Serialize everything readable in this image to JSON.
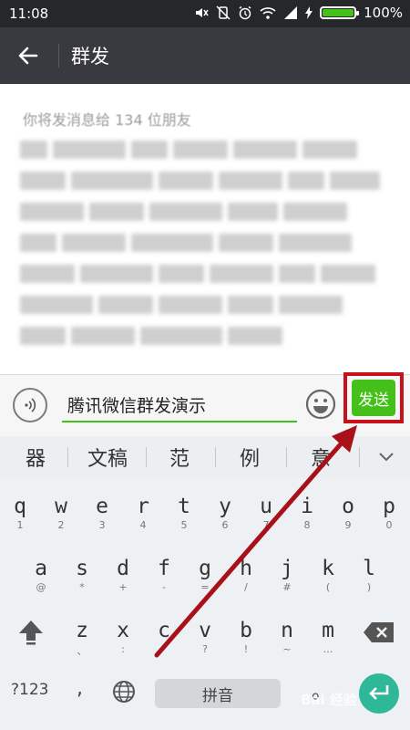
{
  "status_bar": {
    "time": "11:08",
    "battery_label": "100%",
    "battery_level": 1.0,
    "icons": [
      "mute-icon",
      "vibrate-off-icon",
      "alarm-icon",
      "wifi-icon",
      "signal-icon",
      "battery-icon"
    ]
  },
  "title_bar": {
    "back_icon": "back-arrow-icon",
    "title": "群发"
  },
  "content": {
    "recipient_text": "你将发消息给 134 位朋友"
  },
  "input_bar": {
    "voice_icon": "voice-icon",
    "message_value": "腾讯微信群发演示",
    "emoji_icon": "emoji-icon",
    "send_label": "发送"
  },
  "candidates": {
    "items": [
      "器",
      "文稿",
      "范",
      "例",
      "意"
    ],
    "collapse_icon": "chevron-down-icon"
  },
  "keyboard": {
    "row1": [
      {
        "main": "q",
        "sub": "1"
      },
      {
        "main": "w",
        "sub": "2"
      },
      {
        "main": "e",
        "sub": "3"
      },
      {
        "main": "r",
        "sub": "4"
      },
      {
        "main": "t",
        "sub": "5"
      },
      {
        "main": "y",
        "sub": "6"
      },
      {
        "main": "u",
        "sub": "7"
      },
      {
        "main": "i",
        "sub": "8"
      },
      {
        "main": "o",
        "sub": "9"
      },
      {
        "main": "p",
        "sub": "0"
      }
    ],
    "row2": [
      {
        "main": "a",
        "sub": "@"
      },
      {
        "main": "s",
        "sub": "*"
      },
      {
        "main": "d",
        "sub": "+"
      },
      {
        "main": "f",
        "sub": "-"
      },
      {
        "main": "g",
        "sub": "="
      },
      {
        "main": "h",
        "sub": "/"
      },
      {
        "main": "j",
        "sub": "#"
      },
      {
        "main": "k",
        "sub": "("
      },
      {
        "main": "l",
        "sub": ")"
      }
    ],
    "row3": [
      {
        "main": "z",
        "sub": "、"
      },
      {
        "main": "x",
        "sub": ":"
      },
      {
        "main": "c",
        "sub": "'"
      },
      {
        "main": "v",
        "sub": "?"
      },
      {
        "main": "b",
        "sub": "!"
      },
      {
        "main": "n",
        "sub": "~"
      },
      {
        "main": "m",
        "sub": "…"
      }
    ],
    "symbols_label": "?123",
    "comma_label": ",",
    "globe_icon": "globe-icon",
    "space_label": "拼音",
    "period_label": "。",
    "shift_icon": "shift-icon",
    "delete_icon": "backspace-icon",
    "enter_icon": "enter-icon"
  },
  "watermark": "Bai 经验",
  "colors": {
    "accent_green": "#45c01a",
    "highlight_red": "#c8101a",
    "title_bar": "#393a3f",
    "enter_teal": "#2fb79a"
  }
}
